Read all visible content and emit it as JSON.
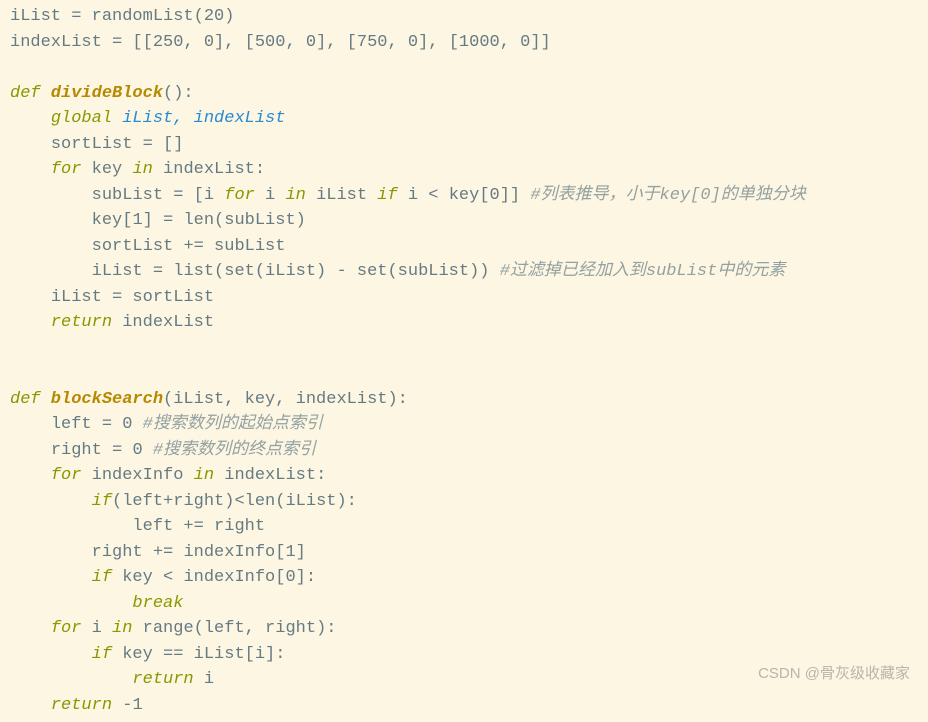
{
  "code": {
    "l01": {
      "a": "iList = randomList(",
      "b": "20",
      "c": ")"
    },
    "l02": {
      "a": "indexList = [[",
      "b": "250",
      "c": ", ",
      "d": "0",
      "e": "], [",
      "f": "500",
      "g": ", ",
      "h": "0",
      "i": "], [",
      "j": "750",
      "k": ", ",
      "l": "0",
      "m": "], [",
      "n": "1000",
      "o": ", ",
      "p": "0",
      "q": "]]"
    },
    "l04": {
      "def": "def",
      "name": " divideBlock",
      "sig": "():"
    },
    "l05": {
      "kw": "global",
      "rest": " iList, indexList"
    },
    "l06": {
      "a": "sortList = []"
    },
    "l07": {
      "for": "for",
      "a": " key ",
      "in": "in",
      "b": " indexList:"
    },
    "l08": {
      "a": "subList = [i ",
      "for": "for",
      "b": " i ",
      "in": "in",
      "c": " iList ",
      "if": "if",
      "d": " i < key[",
      "n": "0",
      "e": "]] ",
      "cmt": "#列表推导，小于key[0]的单独分块"
    },
    "l09": {
      "a": "key[",
      "n": "1",
      "b": "] = len(subList)"
    },
    "l10": {
      "a": "sortList += subList"
    },
    "l11": {
      "a": "iList = list(set(iList) - set(subList)) ",
      "cmt": "#过滤掉已经加入到subList中的元素"
    },
    "l12": {
      "a": "iList = sortList"
    },
    "l13": {
      "kw": "return",
      "a": " indexList"
    },
    "l16": {
      "def": "def",
      "name": " blockSearch",
      "sig": "(iList, key, indexList):"
    },
    "l17": {
      "a": "left = ",
      "n": "0",
      "sp": " ",
      "cmt": "#搜索数列的起始点索引"
    },
    "l18": {
      "a": "right = ",
      "n": "0",
      "sp": " ",
      "cmt": "#搜索数列的终点索引"
    },
    "l19": {
      "for": "for",
      "a": " indexInfo ",
      "in": "in",
      "b": " indexList:"
    },
    "l20": {
      "if": "if",
      "a": "(left+right)<len(iList):"
    },
    "l21": {
      "a": "left += right"
    },
    "l22": {
      "a": "right += indexInfo[",
      "n": "1",
      "b": "]"
    },
    "l23": {
      "if": "if",
      "a": " key < indexInfo[",
      "n": "0",
      "b": "]:"
    },
    "l24": {
      "kw": "break"
    },
    "l25": {
      "for": "for",
      "a": " i ",
      "in": "in",
      "b": " range(left, right):"
    },
    "l26": {
      "if": "if",
      "a": " key == iList[i]:"
    },
    "l27": {
      "kw": "return",
      "a": " i"
    },
    "l28": {
      "kw": "return",
      "a": " -",
      "n": "1"
    }
  },
  "watermark": "CSDN @骨灰级收藏家"
}
